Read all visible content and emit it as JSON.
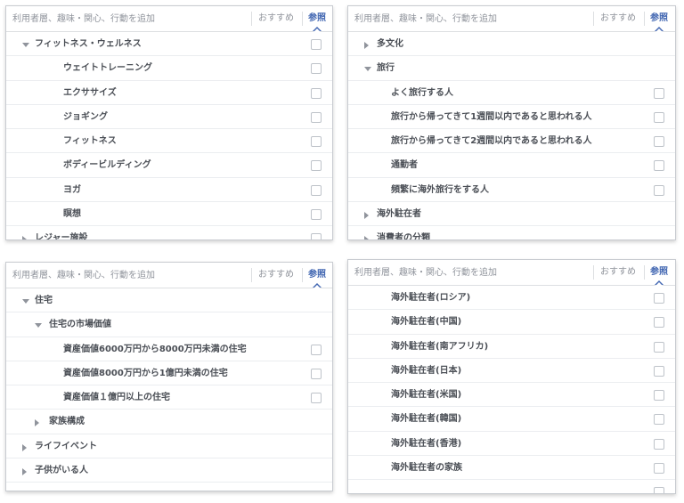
{
  "colors": {
    "accent": "#4267b2",
    "muted_text": "#90949c",
    "item_text": "#4b4f56",
    "border": "#c9ccd1"
  },
  "panels": [
    {
      "search_placeholder": "利用者層、趣味・関心、行動を追加",
      "tab_recommended": "おすすめ",
      "tab_browse": "参照",
      "items": [
        {
          "label": "フィットネス・ウェルネス",
          "level": 0,
          "expander": "down",
          "checkbox": true
        },
        {
          "label": "ウェイトトレーニング",
          "level": 2,
          "expander": "none",
          "checkbox": true
        },
        {
          "label": "エクササイズ",
          "level": 2,
          "expander": "none",
          "checkbox": true
        },
        {
          "label": "ジョギング",
          "level": 2,
          "expander": "none",
          "checkbox": true
        },
        {
          "label": "フィットネス",
          "level": 2,
          "expander": "none",
          "checkbox": true
        },
        {
          "label": "ボディービルディング",
          "level": 2,
          "expander": "none",
          "checkbox": true
        },
        {
          "label": "ヨガ",
          "level": 2,
          "expander": "none",
          "checkbox": true
        },
        {
          "label": "瞑想",
          "level": 2,
          "expander": "none",
          "checkbox": true
        },
        {
          "label": "レジャー施設",
          "level": 0,
          "expander": "right",
          "checkbox": true
        }
      ]
    },
    {
      "search_placeholder": "利用者層、趣味・関心、行動を追加",
      "tab_recommended": "おすすめ",
      "tab_browse": "参照",
      "items": [
        {
          "label": "多文化",
          "level": 0,
          "expander": "right",
          "checkbox": false
        },
        {
          "label": "旅行",
          "level": 0,
          "expander": "down",
          "checkbox": false
        },
        {
          "label": "よく旅行する人",
          "level": 1,
          "expander": "none",
          "checkbox": true
        },
        {
          "label": "旅行から帰ってきて1週間以内であると思われる人",
          "level": 1,
          "expander": "none",
          "checkbox": true
        },
        {
          "label": "旅行から帰ってきて2週間以内であると思われる人",
          "level": 1,
          "expander": "none",
          "checkbox": true
        },
        {
          "label": "通勤者",
          "level": 1,
          "expander": "none",
          "checkbox": true
        },
        {
          "label": "頻繁に海外旅行をする人",
          "level": 1,
          "expander": "none",
          "checkbox": true
        },
        {
          "label": "海外駐在者",
          "level": 0,
          "expander": "right",
          "checkbox": false
        },
        {
          "label": "消費者の分類",
          "level": 0,
          "expander": "right",
          "checkbox": false
        }
      ]
    },
    {
      "search_placeholder": "利用者層、趣味・関心、行動を追加",
      "tab_recommended": "おすすめ",
      "tab_browse": "参照",
      "items": [
        {
          "label": "住宅",
          "level": 0,
          "expander": "down",
          "checkbox": false
        },
        {
          "label": "住宅の市場価値",
          "level": 1,
          "expander": "down",
          "checkbox": false
        },
        {
          "label": "資産価値6000万円から8000万円未満の住宅",
          "level": 2,
          "expander": "none",
          "checkbox": true
        },
        {
          "label": "資産価値8000万円から1億円未満の住宅",
          "level": 2,
          "expander": "none",
          "checkbox": true
        },
        {
          "label": "資産価値１億円以上の住宅",
          "level": 2,
          "expander": "none",
          "checkbox": true
        },
        {
          "label": "家族構成",
          "level": 1,
          "expander": "right",
          "checkbox": false
        },
        {
          "label": "ライフイベント",
          "level": 0,
          "expander": "right",
          "checkbox": false
        },
        {
          "label": "子供がいる人",
          "level": 0,
          "expander": "right",
          "checkbox": false
        }
      ]
    },
    {
      "search_placeholder": "利用者層、趣味・関心、行動を追加",
      "tab_recommended": "おすすめ",
      "tab_browse": "参照",
      "items": [
        {
          "label": "海外駐在者(ロシア)",
          "level": 1,
          "expander": "none",
          "checkbox": true
        },
        {
          "label": "海外駐在者(中国)",
          "level": 1,
          "expander": "none",
          "checkbox": true
        },
        {
          "label": "海外駐在者(南アフリカ)",
          "level": 1,
          "expander": "none",
          "checkbox": true
        },
        {
          "label": "海外駐在者(日本)",
          "level": 1,
          "expander": "none",
          "checkbox": true
        },
        {
          "label": "海外駐在者(米国)",
          "level": 1,
          "expander": "none",
          "checkbox": true
        },
        {
          "label": "海外駐在者(韓国)",
          "level": 1,
          "expander": "none",
          "checkbox": true
        },
        {
          "label": "海外駐在者(香港)",
          "level": 1,
          "expander": "none",
          "checkbox": true
        },
        {
          "label": "海外駐在者の家族",
          "level": 1,
          "expander": "none",
          "checkbox": true
        },
        {
          "label": "",
          "level": 1,
          "expander": "none",
          "checkbox": true
        }
      ]
    }
  ]
}
